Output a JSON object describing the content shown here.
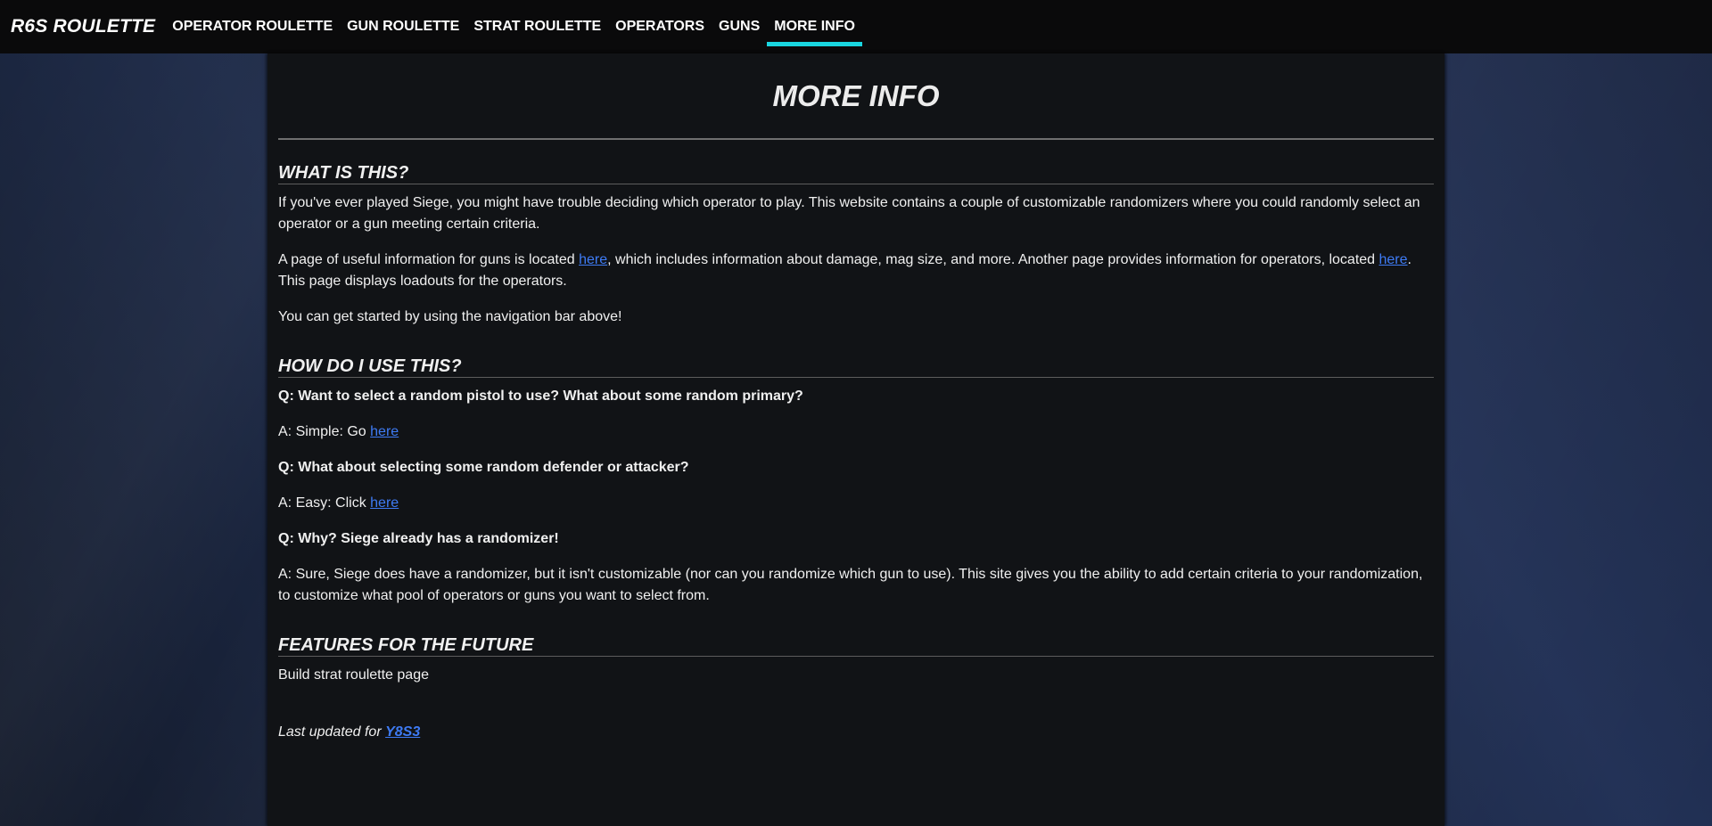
{
  "brand": "R6S ROULETTE",
  "nav": {
    "items": [
      {
        "label": "OPERATOR ROULETTE"
      },
      {
        "label": "GUN ROULETTE"
      },
      {
        "label": "STRAT ROULETTE"
      },
      {
        "label": "OPERATORS"
      },
      {
        "label": "GUNS"
      },
      {
        "label": "MORE INFO"
      }
    ],
    "active": "MORE INFO",
    "accent_color": "#19d6e0"
  },
  "page": {
    "title": "MORE INFO",
    "sections": {
      "what": {
        "title": "WHAT IS THIS?",
        "p1": "If you've ever played Siege, you might have trouble deciding which operator to play. This website contains a couple of customizable randomizers where you could randomly select an operator or a gun meeting certain criteria.",
        "p2_a": "A page of useful information for guns is located ",
        "p2_link1": "here",
        "p2_b": ", which includes information about damage, mag size, and more. Another page provides information for operators, located ",
        "p2_link2": "here",
        "p2_c": ". This page displays loadouts for the operators.",
        "p3": "You can get started by using the navigation bar above!"
      },
      "how": {
        "title": "HOW DO I USE THIS?",
        "q1": "Q: Want to select a random pistol to use? What about some random primary?",
        "a1_text": "A: Simple: Go ",
        "a1_link": "here",
        "q2": "Q: What about selecting some random defender or attacker?",
        "a2_text": "A: Easy: Click ",
        "a2_link": "here",
        "q3": "Q: Why? Siege already has a randomizer!",
        "a3": "A: Sure, Siege does have a randomizer, but it isn't customizable (nor can you randomize which gun to use). This site gives you the ability to add certain criteria to your randomization, to customize what pool of operators or guns you want to select from."
      },
      "future": {
        "title": "FEATURES FOR THE FUTURE",
        "item": "Build strat roulette page"
      }
    },
    "updated_text": "Last updated for ",
    "updated_link": "Y8S3"
  },
  "colors": {
    "link": "#3e7bf4",
    "panel": "#111316",
    "navbar": "#0a0a0b"
  }
}
